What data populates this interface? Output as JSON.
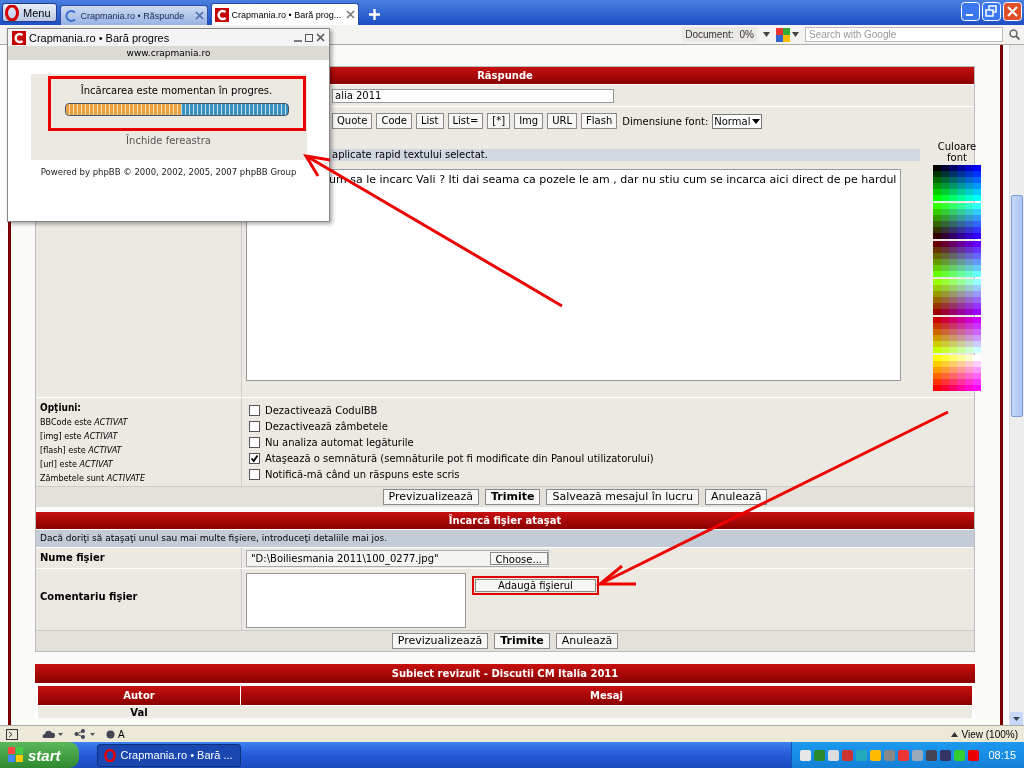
{
  "browser": {
    "menu_label": "Menu",
    "tabs": [
      {
        "title": "Crapmania.ro • Răspunde",
        "selected": false
      },
      {
        "title": "Crapmania.ro • Bară prog...",
        "selected": true
      }
    ],
    "document_label": "Document:",
    "document_progress": "0%",
    "search": {
      "placeholder": "Search with Google"
    }
  },
  "popup": {
    "title": "Crapmania.ro • Bară progres",
    "url": "www.crapmania.ro",
    "message": "Încărcarea este momentan în progres.",
    "progress": {
      "level": 0.52
    },
    "close_link": "Închide fereastra",
    "footer": "Powered by phpBB © 2000, 2002, 2005, 2007 phpBB Group"
  },
  "reply_form": {
    "title": "Răspunde",
    "subject": {
      "value": "alia 2011"
    },
    "format_buttons": [
      "Quote",
      "Code",
      "List",
      "List=",
      "[*]",
      "Img",
      "URL",
      "Flash"
    ],
    "font_size_label": "Dimensiune font:",
    "font_size": "Normal",
    "help_line": "aplicate rapid textului selectat.",
    "message": "um sa le incarc Vali ? Iti dai seama ca pozele le am , dar nu stiu cum se incarca aici direct de pe hardul",
    "color_label": "Culoare font"
  },
  "options": {
    "title": "Opţiuni:",
    "status_lines": [
      "BBCode este *ACTIVAT*",
      "[img] este *ACTIVAT*",
      "[flash] este *ACTIVAT*",
      "[url] este *ACTIVAT*",
      "Zâmbetele sunt *ACTIVATE*"
    ],
    "checkboxes": [
      {
        "label": "Dezactivează CodulBB",
        "checked": false
      },
      {
        "label": "Dezactivează zâmbetele",
        "checked": false
      },
      {
        "label": "Nu analiza automat legăturile",
        "checked": false
      },
      {
        "label": "Ataşează o semnătură (semnăturile pot fi modificate din Panoul utilizatorului)",
        "checked": true
      },
      {
        "label": "Notifică-mă când un răspuns este scris",
        "checked": false
      }
    ]
  },
  "form_buttons": [
    {
      "label": "Previzualizează",
      "primary": false
    },
    {
      "label": "Trimite",
      "primary": true
    },
    {
      "label": "Salvează mesajul în lucru",
      "primary": false
    },
    {
      "label": "Anulează",
      "primary": false
    }
  ],
  "attachment": {
    "title": "Încarcă fişier ataşat",
    "info": "Dacă doriţi să ataşaţi unul sau mai multe fişiere, introduceţi detaliile mai jos.",
    "file_label": "Nume fişier",
    "file_value": "\"D:\\Boiliesmania 2011\\100_0277.jpg\"",
    "choose_button": "Choose...",
    "comment_label": "Comentariu fişier",
    "add_button": "Adaugă fişierul",
    "buttons": [
      {
        "label": "Previzualizează",
        "primary": false
      },
      {
        "label": "Trimite",
        "primary": true
      },
      {
        "label": "Anulează",
        "primary": false
      }
    ]
  },
  "review": {
    "title": "Subiect revizuit - Discutii CM Italia 2011",
    "columns": [
      "Autor",
      "Mesaj"
    ],
    "rows": [
      {
        "author": "Val"
      }
    ]
  },
  "status_bar": {
    "font_label": "A",
    "zoom": "View (100%)"
  },
  "taskbar": {
    "start": "start",
    "tasks": [
      {
        "title": "Crapmania.ro • Bară ...",
        "selected": true
      }
    ],
    "clock": "08:15"
  }
}
